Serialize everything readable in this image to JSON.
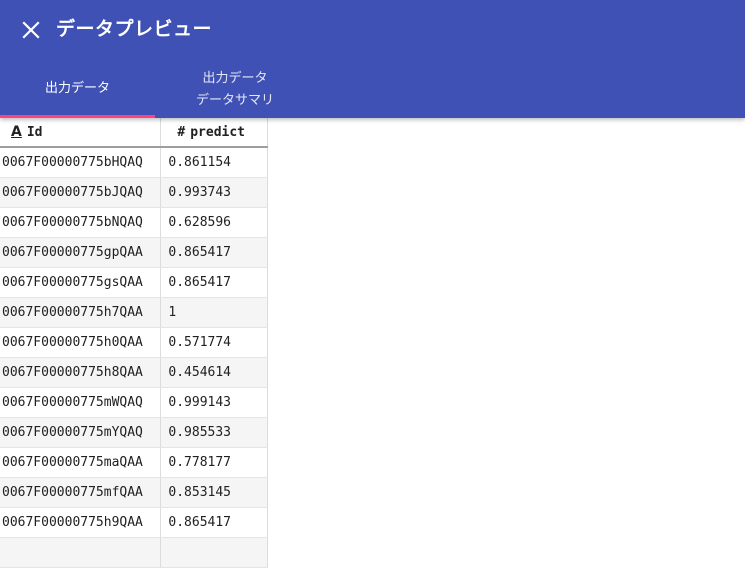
{
  "theme": {
    "accent": "#3f51b5",
    "indicator": "#ff4081"
  },
  "header": {
    "close_icon": "close-icon",
    "title": "データプレビュー"
  },
  "tabs": [
    {
      "label": "出力データ",
      "active": true
    },
    {
      "label_line1": "出力データ",
      "label_line2": "データサマリ",
      "active": false
    }
  ],
  "table": {
    "columns": [
      {
        "type_icon": "A",
        "type_name": "text-type-icon",
        "label": "Id"
      },
      {
        "type_icon": "#",
        "type_name": "number-type-icon",
        "label": "predict"
      }
    ],
    "rows": [
      [
        "0067F00000775bHQAQ",
        "0.861154"
      ],
      [
        "0067F00000775bJQAQ",
        "0.993743"
      ],
      [
        "0067F00000775bNQAQ",
        "0.628596"
      ],
      [
        "0067F00000775gpQAA",
        "0.865417"
      ],
      [
        "0067F00000775gsQAA",
        "0.865417"
      ],
      [
        "0067F00000775h7QAA",
        "1"
      ],
      [
        "0067F00000775h0QAA",
        "0.571774"
      ],
      [
        "0067F00000775h8QAA",
        "0.454614"
      ],
      [
        "0067F00000775mWQAQ",
        "0.999143"
      ],
      [
        "0067F00000775mYQAQ",
        "0.985533"
      ],
      [
        "0067F00000775maQAA",
        "0.778177"
      ],
      [
        "0067F00000775mfQAA",
        "0.853145"
      ],
      [
        "0067F00000775h9QAA",
        "0.865417"
      ],
      [
        "",
        ""
      ]
    ]
  }
}
